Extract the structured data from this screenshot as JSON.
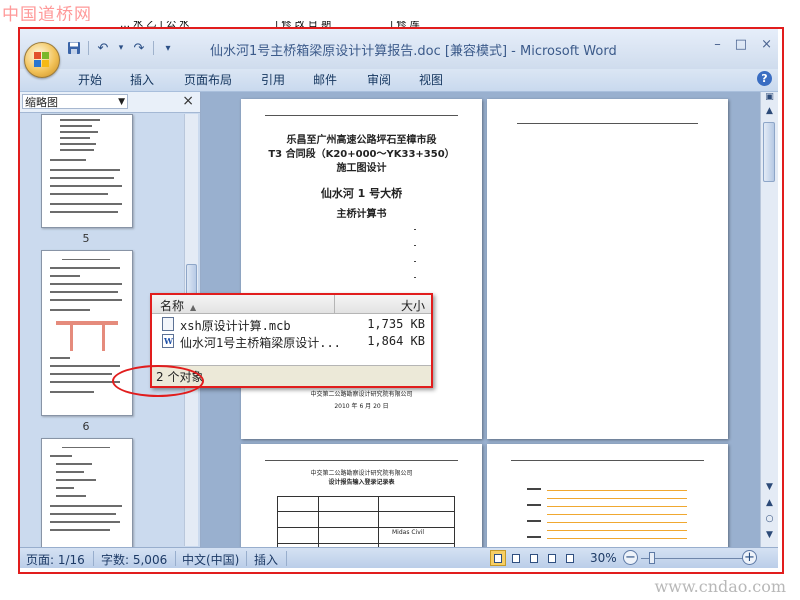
{
  "watermark": {
    "top": "中国道桥网",
    "bottom": "www.cndao.com"
  },
  "peek_table": {
    "col1": "… 水 乙 | 公 水",
    "col2": "| 修 改 日 期",
    "col3": "| 修 库"
  },
  "window": {
    "title": "仙水河1号主桥箱梁原设计计算报告.doc [兼容模式] - Microsoft Word",
    "controls": {
      "minimize": "–",
      "maximize": "□",
      "close": "×"
    }
  },
  "quick_access": {
    "save_icon": "save-icon",
    "undo": "↶",
    "redo": "↷",
    "more": "▾"
  },
  "ribbon_tabs": [
    "开始",
    "插入",
    "页面布局",
    "引用",
    "邮件",
    "审阅",
    "视图"
  ],
  "help_label": "?",
  "nav_pane": {
    "view_select": "缩略图",
    "close": "×",
    "thumbnails": [
      {
        "number": "5"
      },
      {
        "number": "6"
      }
    ]
  },
  "document": {
    "cover": {
      "line1": "乐昌至广州高速公路坪石至樟市段",
      "line2": "T3 合同段（K20+000～YK33+350）",
      "line3": "施工图设计",
      "line4": "仙水河 1 号大桥",
      "line5": "主桥计算书",
      "company": "中交第二公路勘察设计研究院有限公司",
      "date": "2010 年 6 月 20 日"
    },
    "page3": {
      "org": "中交第二公路勘察设计研究院有限公司",
      "title": "设计报告输入登录记录表",
      "cell": "Midas Civil"
    }
  },
  "popup": {
    "col_name": "名称",
    "col_size": "大小",
    "sort_icon": "▲",
    "files": [
      {
        "name": "xsh原设计计算.mcb",
        "size": "1,735 KB",
        "icon": "file-icon"
      },
      {
        "name": "仙水河1号主桥箱梁原设计...",
        "size": "1,864 KB",
        "icon": "word-icon"
      }
    ],
    "status": "2 个对象"
  },
  "statusbar": {
    "page": "页面: 1/16",
    "words": "字数: 5,006",
    "language": "中文(中国)",
    "mode": "插入",
    "zoom": "30%",
    "zoom_out": "−",
    "zoom_in": "+",
    "zoom_level": 0.3
  },
  "colors": {
    "annotation_red": "#e11d1d",
    "doc_background": "#99b0cf",
    "ribbon": "#c9d9ee"
  }
}
